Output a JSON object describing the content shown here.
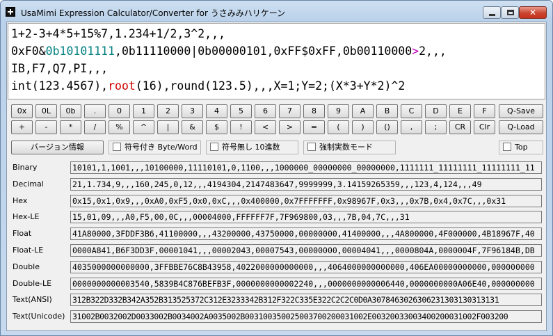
{
  "window": {
    "title": "UsaMimi Expression Calculator/Converter  for うさみみハリケーン",
    "close_label": "✕"
  },
  "editor": {
    "line1": "1+2-3+4*5+15%7,1.234+1/2,3^2,,,",
    "line2_a": "0xF0&",
    "line2_b": "0b10101111",
    "line2_c": ",0b11110000|0b00000101,0xFF$0xFF,0b00110000",
    "line2_d": ">",
    "line2_e": "2,,,",
    "line3": "IB,F7,Q7,PI,,,",
    "line4_a": "int(123.4567),",
    "line4_b": "root",
    "line4_c": "(16),round(123.5),,,X=1;Y=2;(X*3+Y*2)^2"
  },
  "keypad": {
    "row1": [
      "0x",
      "0L",
      "0b",
      ".",
      "0",
      "1",
      "2",
      "3",
      "4",
      "5",
      "6",
      "7",
      "8",
      "9",
      "A",
      "B",
      "C",
      "D",
      "E",
      "F"
    ],
    "row1_action": "Q-Save",
    "row2": [
      "+",
      "-",
      "*",
      "/",
      "%",
      "^",
      "|",
      "&",
      "$",
      "!",
      "<",
      ">",
      "=",
      "(",
      ")",
      "()",
      ",",
      ";",
      "CR",
      "Clr"
    ],
    "row2_action": "Q-Load"
  },
  "options": {
    "version_button": "バージョン情報",
    "signed_label": "符号付き Byte/Word",
    "unsigned_label": "符号無し 10進数",
    "force_real_label": "強制実数モード",
    "top_label": "Top"
  },
  "results": [
    {
      "label": "Binary",
      "value": "10101,1,1001,,,10100000,11110101,0,1100,,,1000000_00000000_00000000,1111111_11111111_11111111_11"
    },
    {
      "label": "Decimal",
      "value": "21,1.734,9,,,160,245,0,12,,,4194304,2147483647,9999999,3.14159265359,,,123,4,124,,,49"
    },
    {
      "label": "Hex",
      "value": "0x15,0x1,0x9,,,0xA0,0xF5,0x0,0xC,,,0x400000,0x7FFFFFFF,0x98967F,0x3,,,0x7B,0x4,0x7C,,,0x31"
    },
    {
      "label": "Hex-LE",
      "value": "15,01,09,,,A0,F5,00,0C,,,00004000,FFFFFF7F,7F969800,03,,,7B,04,7C,,,31"
    },
    {
      "label": "Float",
      "value": "41A80000,3FDDF3B6,41100000,,,43200000,43750000,00000000,41400000,,,4A800000,4F000000,4B18967F,40"
    },
    {
      "label": "Float-LE",
      "value": "0000A841,B6F3DD3F,00001041,,,00002043,00007543,00000000,00004041,,,0000804A,0000004F,7F96184B,DB"
    },
    {
      "label": "Double",
      "value": "4035000000000000,3FFBBE76C8B43958,4022000000000000,,,4064000000000000,406EA00000000000,000000000"
    },
    {
      "label": "Double-LE",
      "value": "0000000000003540,5839B4C876BEFB3F,0000000000002240,,,0000000000006440,0000000000A06E40,000000000"
    },
    {
      "label": "Text(ANSI)",
      "value": "312B322D332B342A352B313525372C312E3233342B312F322C335E322C2C2C0D0A3078463026306231303130313131"
    },
    {
      "label": "Text(Unicode)",
      "value": "31002B0032002D0033002B0034002A0035002B003100350025003700200031002E00320033003400200031002F003200"
    }
  ]
}
